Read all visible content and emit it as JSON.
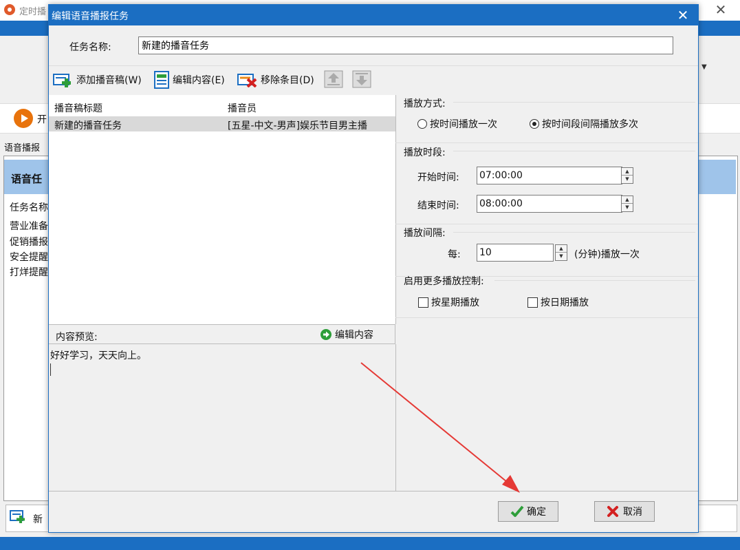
{
  "bg": {
    "title": "定时播",
    "start_label": "开",
    "tab_label": "语音播报",
    "panel_head": "语音任",
    "col_name": "任务名称",
    "rows": [
      "营业准备",
      "促销播报",
      "安全提醒",
      "打烊提醒"
    ],
    "add_label": "新"
  },
  "dialog": {
    "title": "编辑语音播报任务",
    "task_name_label": "任务名称:",
    "task_name_value": "新建的播音任务",
    "toolbar": {
      "add": "添加播音稿(W)",
      "edit": "编辑内容(E)",
      "remove": "移除条目(D)"
    },
    "list": {
      "headers": [
        "播音稿标题",
        "播音员"
      ],
      "rows": [
        {
          "title": "新建的播音任务",
          "announcer": "[五星-中文-男声]娱乐节目男主播"
        }
      ]
    },
    "preview": {
      "label": "内容预览:",
      "edit": "编辑内容",
      "text": "好好学习，天天向上。"
    },
    "settings": {
      "mode_title": "播放方式:",
      "mode_once": "按时间播放一次",
      "mode_interval": "按时间段间隔播放多次",
      "mode_selected": "interval",
      "period_title": "播放时段:",
      "start_label": "开始时间:",
      "start_value": "07:00:00",
      "end_label": "结束时间:",
      "end_value": "08:00:00",
      "interval_title": "播放间隔:",
      "every_label": "每:",
      "every_value": "10",
      "every_suffix": "(分钟)播放一次",
      "more_title": "启用更多播放控制:",
      "by_week": "按星期播放",
      "by_date": "按日期播放"
    },
    "buttons": {
      "ok": "确定",
      "cancel": "取消"
    }
  },
  "colors": {
    "accent": "#1b6ec2",
    "selection": "#d9d9d9",
    "arrow": "#e53935"
  }
}
